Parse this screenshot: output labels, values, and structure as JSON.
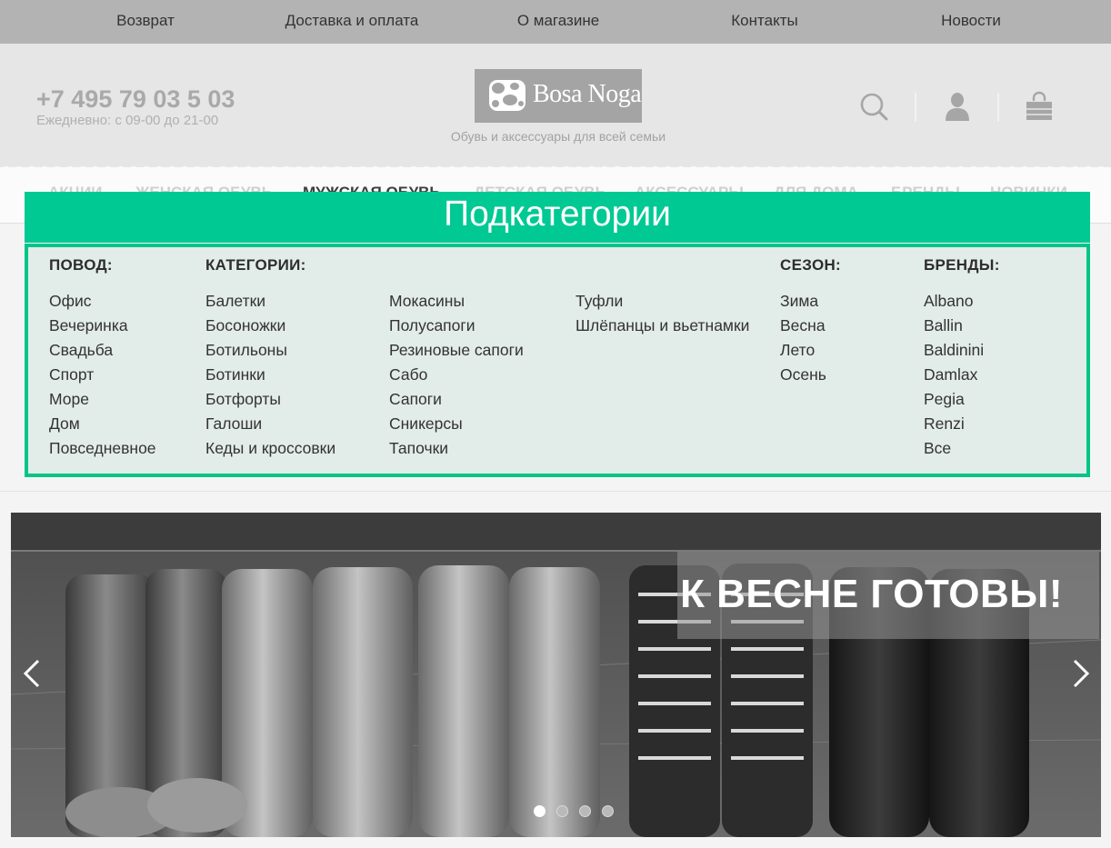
{
  "top_links": [
    "Возврат",
    "Доставка и оплата",
    "О магазине",
    "Контакты",
    "Новости"
  ],
  "header": {
    "phone": "+7 495 79 03 5 03",
    "hours": "Ежедневно: с 09-00 до 21-00",
    "logo_text": "Bosa Noga",
    "tagline": "Обувь и аксессуары для всей семьи",
    "icons": [
      "search-icon",
      "user-icon",
      "cart-icon"
    ]
  },
  "nav": {
    "items": [
      "АКЦИИ",
      "ЖЕНСКАЯ ОБУВЬ",
      "МУЖСКАЯ ОБУВЬ",
      "ДЕТСКАЯ ОБУВЬ",
      "АКСЕССУАРЫ",
      "ДЛЯ ДОМА",
      "БРЕНДЫ",
      "НОВИНКИ"
    ],
    "active": "МУЖСКАЯ ОБУВЬ"
  },
  "subcategories_label": "Подкатегории",
  "dropdown": {
    "occasion_title": "ПОВОД:",
    "occasion": [
      "Офис",
      "Вечеринка",
      "Свадьба",
      "Спорт",
      "Море",
      "Дом",
      "Повседневное"
    ],
    "categories_title": "КАТЕГОРИИ:",
    "categories_col1": [
      "Балетки",
      "Босоножки",
      "Ботильоны",
      "Ботинки",
      "Ботфорты",
      "Галоши",
      "Кеды и кроссовки"
    ],
    "categories_col2": [
      "Мокасины",
      "Полусапоги",
      "Резиновые сапоги",
      "Сабо",
      "Сапоги",
      "Сникерсы",
      "Тапочки"
    ],
    "categories_col3": [
      "Туфли",
      "Шлёпанцы и вьетнамки"
    ],
    "season_title": "СЕЗОН:",
    "season": [
      "Зима",
      "Весна",
      "Лето",
      "Осень"
    ],
    "brands_title": "БРЕНДЫ:",
    "brands": [
      "Albano",
      "Ballin",
      "Baldinini",
      "Damlax",
      "Pegia",
      "Renzi",
      "Все"
    ]
  },
  "slider": {
    "title": "К ВЕСНЕ ГОТОВЫ!",
    "slide_count": 4,
    "active_slide": 1,
    "prev_icon": "chevron-left-icon",
    "next_icon": "chevron-right-icon"
  },
  "colors": {
    "accent_green": "#00c993",
    "panel_border": "#05c488",
    "panel_bg": "#e2ece9"
  }
}
